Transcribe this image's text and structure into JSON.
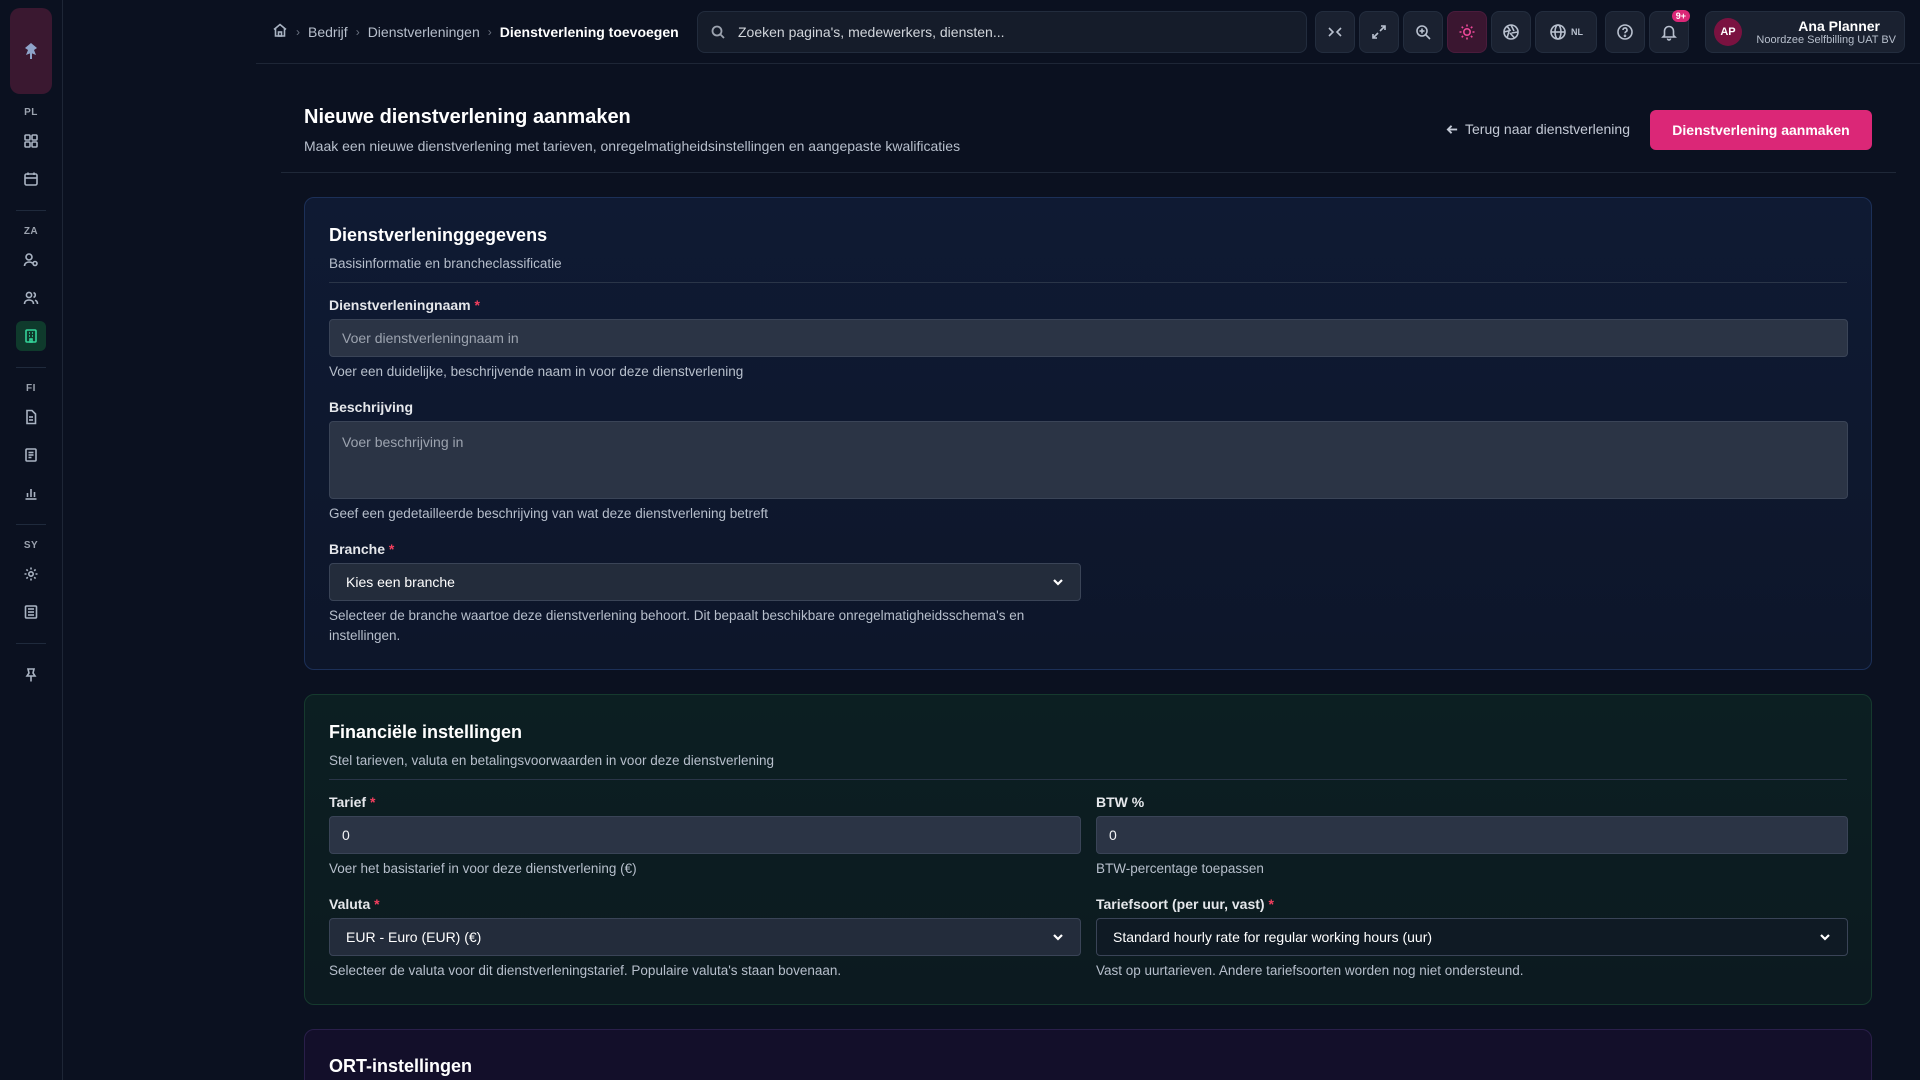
{
  "breadcrumb": {
    "items": [
      "Bedrijf",
      "Dienstverleningen"
    ],
    "current": "Dienstverlening toevoegen"
  },
  "search": {
    "placeholder": "Zoeken pagina's, medewerkers, diensten..."
  },
  "toolbar": {
    "language": "NL",
    "notifications_badge": "9+"
  },
  "user": {
    "initials": "AP",
    "name": "Ana Planner",
    "organization": "Noordzee Selfbilling UAT BV"
  },
  "sidebar": {
    "groups": [
      {
        "label": "PL",
        "icons": [
          "dashboard-icon",
          "calendar-icon"
        ]
      },
      {
        "label": "ZA",
        "icons": [
          "user-settings-icon",
          "users-icon",
          "building-icon"
        ]
      },
      {
        "label": "FI",
        "icons": [
          "document-icon",
          "invoice-icon",
          "chart-icon"
        ]
      },
      {
        "label": "SY",
        "icons": [
          "gear-icon",
          "log-icon"
        ]
      }
    ],
    "active_icon": "building-icon",
    "footer_icon": "pin-icon"
  },
  "header": {
    "title": "Nieuwe dienstverlening aanmaken",
    "subtitle": "Maak een nieuwe dienstverlening met tarieven, onregelmatigheidsinstellingen en aangepaste kwalificaties",
    "back_label": "Terug naar dienstverlening",
    "submit_label": "Dienstverlening aanmaken"
  },
  "details": {
    "title": "Dienstverleninggegevens",
    "subtitle": "Basisinformatie en brancheclassificatie",
    "name_label": "Dienstverleningnaam",
    "name_placeholder": "Voer dienstverleningnaam in",
    "name_help": "Voer een duidelijke, beschrijvende naam in voor deze dienstverlening",
    "description_label": "Beschrijving",
    "description_placeholder": "Voer beschrijving in",
    "description_help": "Geef een gedetailleerde beschrijving van wat deze dienstverlening betreft",
    "branch_label": "Branche",
    "branch_value": "Kies een branche",
    "branch_help": "Selecteer de branche waartoe deze dienstverlening behoort. Dit bepaalt beschikbare onregelmatigheidsschema's en instellingen."
  },
  "financial": {
    "title": "Financiële instellingen",
    "subtitle": "Stel tarieven, valuta en betalingsvoorwaarden in voor deze dienstverlening",
    "rate_label": "Tarief",
    "rate_value": "0",
    "rate_help": "Voer het basistarief in voor deze dienstverlening (€)",
    "vat_label": "BTW %",
    "vat_value": "0",
    "vat_help": "BTW-percentage toepassen",
    "currency_label": "Valuta",
    "currency_value": "EUR - Euro (EUR) (€)",
    "currency_help": "Selecteer de valuta voor dit dienstverleningstarief. Populaire valuta's staan bovenaan.",
    "rate_type_label": "Tariefsoort (per uur, vast)",
    "rate_type_value": "Standard hourly rate for regular working hours (uur)",
    "rate_type_help": "Vast op uurtarieven. Andere tariefsoorten worden nog niet ondersteund."
  },
  "ort": {
    "title": "ORT-instellingen"
  },
  "required_marker": "*"
}
